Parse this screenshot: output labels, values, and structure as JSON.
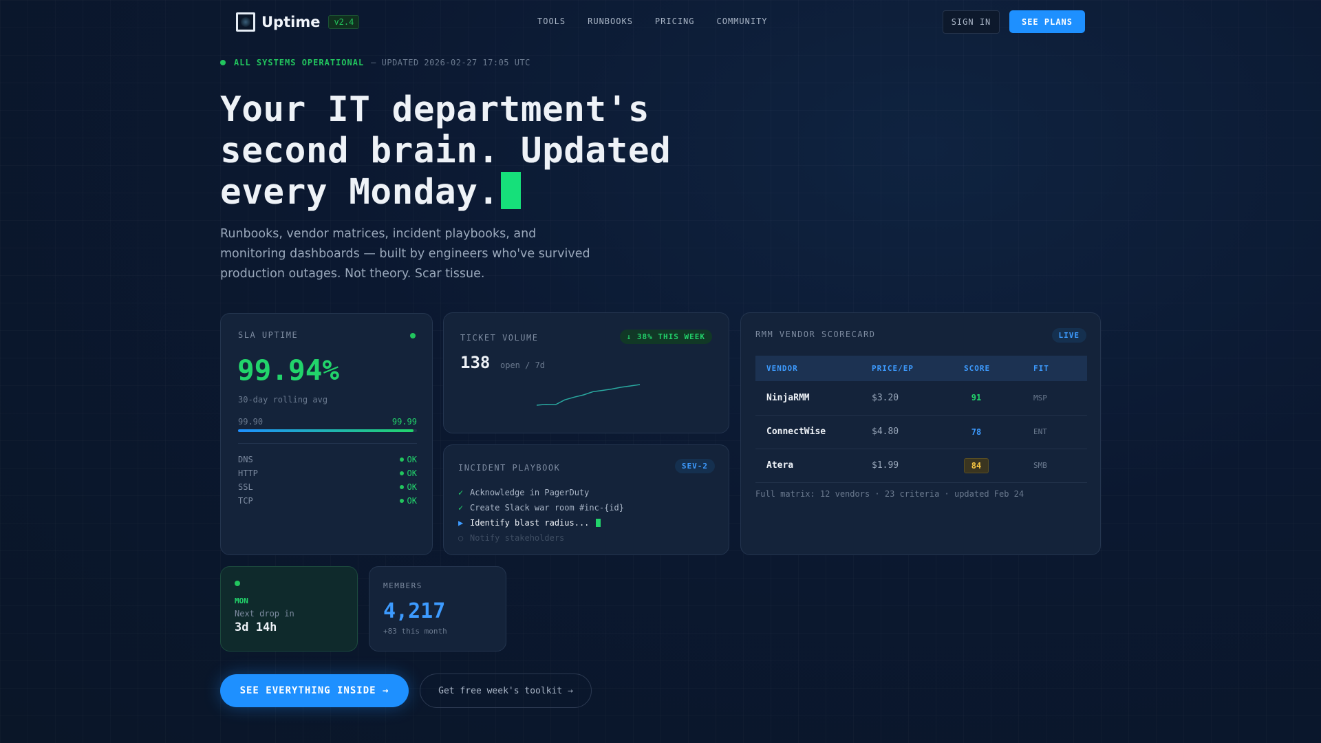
{
  "nav": {
    "brand": "Uptime",
    "version": "v2.4",
    "links": [
      "TOOLS",
      "RUNBOOKS",
      "PRICING",
      "COMMUNITY"
    ],
    "sign_in": "SIGN IN",
    "see_plans": "SEE PLANS"
  },
  "status": {
    "label": "ALL SYSTEMS OPERATIONAL",
    "updated": "— UPDATED 2026-02-27 17:05 UTC",
    "color": "#22c55e"
  },
  "hero": {
    "line1": "Your IT department's",
    "line2": "second brain. Updated",
    "line3": "every Monday.",
    "subtitle": "Runbooks, vendor matrices, incident playbooks, and monitoring dashboards — built by engineers who've survived production outages. Not theory. Scar tissue."
  },
  "sla": {
    "label": "SLA UPTIME",
    "value": "99.94%",
    "sub": "30-day rolling avg",
    "range_low": "99.90",
    "range_high": "99.99",
    "bar_fraction": 0.98,
    "checks": [
      {
        "name": "DNS",
        "status": "OK"
      },
      {
        "name": "HTTP",
        "status": "OK"
      },
      {
        "name": "SSL",
        "status": "OK"
      },
      {
        "name": "TCP",
        "status": "OK"
      }
    ]
  },
  "ticket": {
    "label": "TICKET VOLUME",
    "badge": "↓ 38% THIS WEEK",
    "count": "138",
    "sub": "open / 7d",
    "trend": [
      2,
      3,
      2.5,
      8,
      11,
      13.5,
      17,
      18.5,
      20,
      22,
      23.5,
      25
    ]
  },
  "playbook": {
    "label": "INCIDENT PLAYBOOK",
    "badge": "SEV-2",
    "steps": [
      {
        "mark": "✓",
        "text": "Acknowledge in PagerDuty",
        "state": "done"
      },
      {
        "mark": "✓",
        "text": "Create Slack war room #inc-{id}",
        "state": "done"
      },
      {
        "mark": "▶",
        "text": "Identify blast radius...",
        "state": "active"
      },
      {
        "mark": "○",
        "text": "Notify stakeholders",
        "state": "pending"
      }
    ]
  },
  "rmm": {
    "label": "RMM VENDOR SCORECARD",
    "badge": "LIVE",
    "headers": [
      "VENDOR",
      "PRICE/EP",
      "SCORE",
      "FIT"
    ],
    "rows": [
      {
        "vendor": "NinjaRMM",
        "price": "$3.20",
        "score": "91",
        "fit": "MSP",
        "score_color": "#22d46b"
      },
      {
        "vendor": "ConnectWise",
        "price": "$4.80",
        "score": "78",
        "fit": "ENT",
        "score_color": "#3d9bff"
      },
      {
        "vendor": "Atera",
        "price": "$1.99",
        "score": "84",
        "fit": "SMB",
        "score_color": "#f5c542"
      }
    ],
    "footer": "Full matrix: 12 vendors · 23 criteria · updated Feb 24"
  },
  "drop": {
    "day": "MON",
    "label": "Next drop in",
    "countdown": "3d 14h"
  },
  "members": {
    "label": "MEMBERS",
    "count": "4,217",
    "sub": "+83 this month"
  },
  "cta": {
    "primary": "SEE EVERYTHING INSIDE →",
    "secondary": "Get free week's toolkit →"
  },
  "colors": {
    "accent": "#1e90ff",
    "success": "#22d46b",
    "background": "#0a1628"
  }
}
